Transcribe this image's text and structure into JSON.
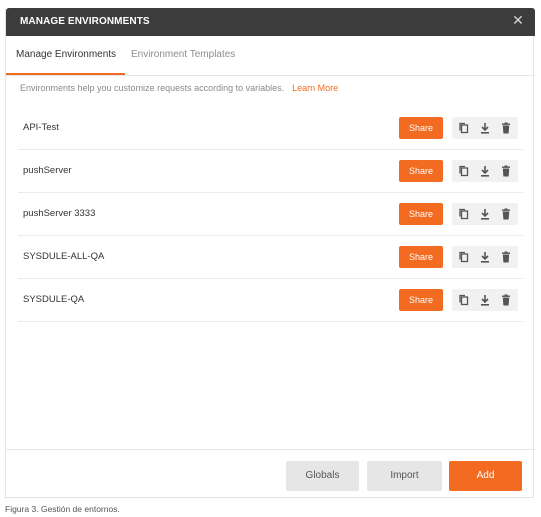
{
  "modal": {
    "title": "MANAGE ENVIRONMENTS",
    "close_glyph": "✕"
  },
  "tabs": [
    {
      "label": "Manage Environments",
      "active": true
    },
    {
      "label": "Environment Templates",
      "active": false
    }
  ],
  "help": {
    "text": "Environments help you customize requests according to variables.",
    "link": "Learn More"
  },
  "environments": [
    {
      "name": "API-Test",
      "share_label": "Share"
    },
    {
      "name": "pushServer",
      "share_label": "Share"
    },
    {
      "name": "pushServer 3333",
      "share_label": "Share"
    },
    {
      "name": "SYSDULE-ALL-QA",
      "share_label": "Share"
    },
    {
      "name": "SYSDULE-QA",
      "share_label": "Share"
    }
  ],
  "row_icons": [
    "copy-icon",
    "download-icon",
    "trash-icon"
  ],
  "footer": {
    "globals_label": "Globals",
    "import_label": "Import",
    "add_label": "Add"
  },
  "caption": "Figura 3. Gestión de entornos.",
  "colors": {
    "accent": "#f26b21",
    "titlebar": "#3c3c3c",
    "secondary_button": "#e6e6e6",
    "icon_group": "#f1f1f1"
  }
}
